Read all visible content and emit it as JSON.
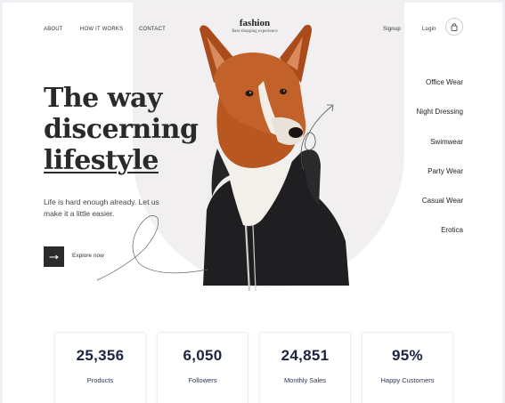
{
  "nav": {
    "links": [
      "ABOUT",
      "HOW IT WORKS",
      "CONTACT"
    ],
    "signup": "Signup",
    "login": "Login"
  },
  "brand": {
    "name": "fashion",
    "tagline": "Best shopping experience"
  },
  "hero": {
    "title_line1": "The way",
    "title_line2": "discerning",
    "title_line3": "lifestyle",
    "description": "Life is hard enough already. Let us make it a little easier.",
    "cta_label": "Explore now"
  },
  "categories": [
    "Office Wear",
    "Night Dressing",
    "Swimwear",
    "Party Wear",
    "Casual Wear",
    "Erotica"
  ],
  "stats": [
    {
      "value": "25,356",
      "label": "Products"
    },
    {
      "value": "6,050",
      "label": "Followers"
    },
    {
      "value": "24,851",
      "label": "Monthly Sales"
    },
    {
      "value": "95%",
      "label": "Happy Customers"
    }
  ],
  "colors": {
    "dark": "#2b2b2b",
    "arch_bg": "#f1eff0",
    "stat_text": "#1d2440"
  },
  "icons": [
    "shopping-bag-icon",
    "arrow-right-icon"
  ]
}
